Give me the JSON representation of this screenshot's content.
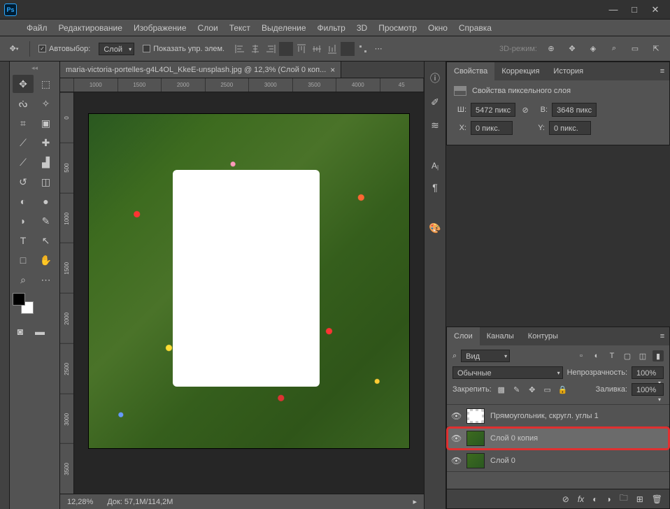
{
  "window": {
    "minimize": "—",
    "maximize": "□",
    "close": "✕"
  },
  "menu": [
    "Файл",
    "Редактирование",
    "Изображение",
    "Слои",
    "Текст",
    "Выделение",
    "Фильтр",
    "3D",
    "Просмотр",
    "Окно",
    "Справка"
  ],
  "options": {
    "auto_select_chk": "Автовыбор:",
    "auto_select_dd": "Слой",
    "show_controls": "Показать упр. элем.",
    "mode3d": "3D-режим:"
  },
  "document": {
    "tab_title": "maria-victoria-portelles-g4L4OL_KkeE-unsplash.jpg @ 12,3% (Слой 0 коп...",
    "zoom": "12,28%",
    "doc_size": "Док: 57,1M/114,2M",
    "ruler_h": [
      "1000",
      "1500",
      "2000",
      "2500",
      "3000",
      "3500",
      "4000",
      "45"
    ],
    "ruler_v": [
      "0",
      "500",
      "1000",
      "1500",
      "2000",
      "2500",
      "3000",
      "3500"
    ]
  },
  "props_panel": {
    "tabs": [
      "Свойства",
      "Коррекция",
      "История"
    ],
    "title": "Свойства пиксельного слоя",
    "W_label": "Ш:",
    "W": "5472 пикс",
    "H_label": "В:",
    "H": "3648 пикс",
    "X_label": "X:",
    "X": "0 пикс.",
    "Y_label": "Y:",
    "Y": "0 пикс."
  },
  "layers_panel": {
    "tabs": [
      "Слои",
      "Каналы",
      "Контуры"
    ],
    "search_placeholder": "Вид",
    "blend_mode": "Обычные",
    "opacity_label": "Непрозрачность:",
    "opacity": "100%",
    "lock_label": "Закрепить:",
    "fill_label": "Заливка:",
    "fill": "100%",
    "layers": [
      {
        "name": "Прямоугольник, скругл. углы 1",
        "thumb": "checker",
        "selected": false
      },
      {
        "name": "Слой 0 копия",
        "thumb": "green",
        "selected": true
      },
      {
        "name": "Слой 0",
        "thumb": "green",
        "selected": false
      }
    ]
  },
  "icons": {
    "move": "✥",
    "marquee": "⬚",
    "lasso": "ᔔ",
    "wand": "✧",
    "crop": "⌗",
    "frame": "▣",
    "eyedrop": "⟋",
    "heal": "✚",
    "brush": "⟋",
    "stamp": "▟",
    "history": "↺",
    "eraser": "◫",
    "gradient": "◐",
    "blur": "●",
    "dodge": "◗",
    "pen": "✎",
    "type": "T",
    "path": "↖",
    "rect": "□",
    "hand": "✋",
    "zoom": "⌕",
    "edit": "⋯"
  }
}
